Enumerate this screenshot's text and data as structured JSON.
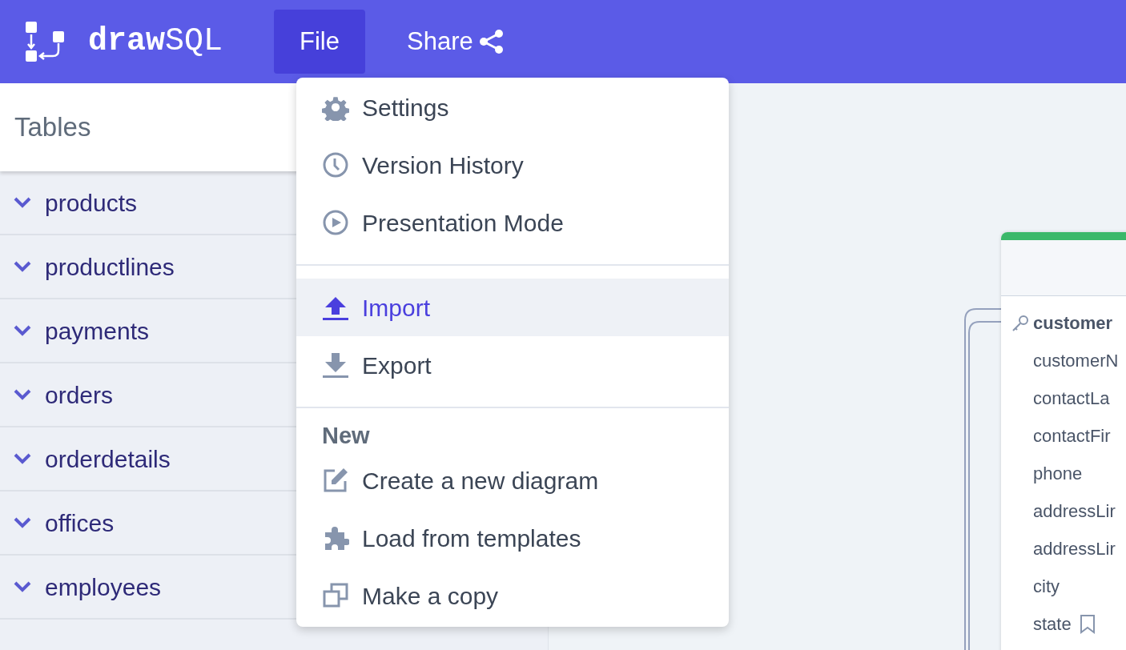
{
  "header": {
    "logo_bold": "draw",
    "logo_light": "SQL",
    "menu": [
      {
        "label": "File",
        "selected": true,
        "kind": "menu"
      },
      {
        "label": "Share",
        "selected": false,
        "kind": "share"
      }
    ]
  },
  "sidebar": {
    "title": "Tables",
    "tables": [
      {
        "name": "products"
      },
      {
        "name": "productlines"
      },
      {
        "name": "payments"
      },
      {
        "name": "orders"
      },
      {
        "name": "orderdetails"
      },
      {
        "name": "offices"
      },
      {
        "name": "employees"
      }
    ]
  },
  "file_menu": {
    "sections": [
      {
        "items": [
          {
            "label": "Settings",
            "selected": false
          },
          {
            "label": "Version History",
            "selected": false
          },
          {
            "label": "Presentation Mode",
            "selected": false
          }
        ]
      },
      {
        "items": [
          {
            "label": "Import",
            "selected": true
          },
          {
            "label": "Export",
            "selected": false
          }
        ]
      },
      {
        "heading": "New",
        "items": [
          {
            "label": "Create a new diagram",
            "selected": false
          },
          {
            "label": "Load from templates",
            "selected": false
          },
          {
            "label": "Make a copy",
            "selected": false
          }
        ]
      }
    ]
  },
  "canvas": {
    "table": {
      "color": "#3bb86a",
      "columns": [
        {
          "name": "customer",
          "kind": "primary"
        },
        {
          "name": "customerN",
          "kind": "plain"
        },
        {
          "name": "contactLa",
          "kind": "plain"
        },
        {
          "name": "contactFir",
          "kind": "plain"
        },
        {
          "name": "phone",
          "kind": "plain"
        },
        {
          "name": "addressLir",
          "kind": "plain"
        },
        {
          "name": "addressLir",
          "kind": "plain"
        },
        {
          "name": "city",
          "kind": "plain"
        },
        {
          "name": "state",
          "kind": "bookmark"
        }
      ]
    }
  }
}
